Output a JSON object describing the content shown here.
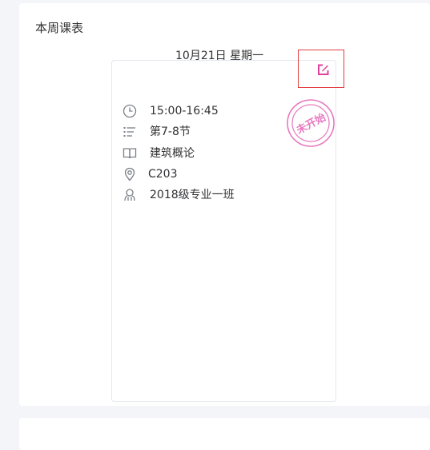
{
  "section": {
    "title": "本周课表"
  },
  "day": {
    "date_label": "10月21日 星期一"
  },
  "course": {
    "time": "15:00-16:45",
    "period": "第7-8节",
    "name": "建筑概论",
    "room": "C203",
    "class_group": "2018级专业一班",
    "status_stamp": "未开始",
    "edit_icon": "edit-icon"
  },
  "colors": {
    "accent": "#e0409b",
    "stamp": "#e879c0",
    "highlight_border": "#e23d3d",
    "icon_gray": "#7b7f87"
  }
}
